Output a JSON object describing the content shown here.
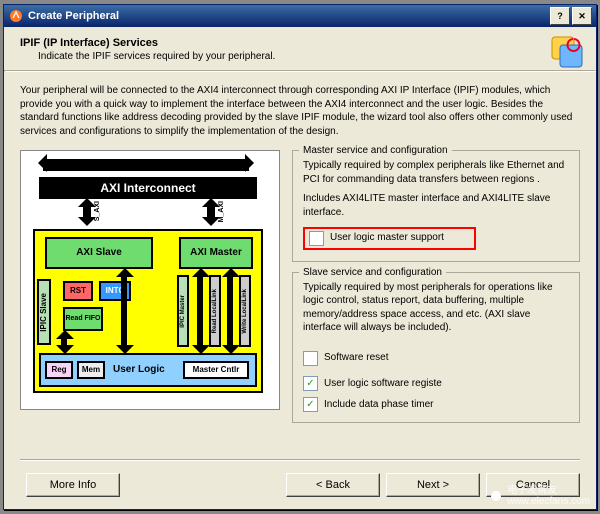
{
  "window": {
    "title": "Create Peripheral"
  },
  "header": {
    "title": "IPIF (IP Interface) Services",
    "subtitle": "Indicate the IPIF services required by your peripheral."
  },
  "intro": "Your peripheral will be connected to the AXI4 interconnect through corresponding AXI IP Interface (IPIF) modules, which provide you with a quick way to implement the interface between the AXI4 interconnect and the user logic. Besides the standard functions like address decoding provided by the slave IPIF module, the wizard tool also offers other commonly used services and configurations to simplify the implementation of the design.",
  "master": {
    "legend": "Master service and configuration",
    "desc1": "Typically required by complex peripherals like Ethernet and PCI for commanding data transfers between regions .",
    "desc2": "Includes AXI4LITE master interface and AXI4LITE slave interface.",
    "opt1": "User logic master support"
  },
  "slave": {
    "legend": "Slave service and configuration",
    "desc": "Typically required by most peripherals for operations like logic control, status report, data buffering, multiple memory/address space access, and etc. (AXI slave interface will always be included).",
    "opt1": "Software reset",
    "opt2": "User logic software registe",
    "opt3": "Include data phase timer"
  },
  "diagram": {
    "interconnect": "AXI Interconnect",
    "s_axi": "S_AXI",
    "m_axi": "M_AXI",
    "axi_slave": "AXI Slave",
    "axi_master": "AXI Master",
    "ipic_slave": "IPIC Slave",
    "ipic_master": "IPIC Master",
    "read_ll": "Read LocalLink",
    "write_ll": "Write LocalLink",
    "rst": "RST",
    "intc": "INTC",
    "read_fifo": "Read FIFO",
    "reg": "Reg",
    "mem": "Mem",
    "user_logic": "User Logic",
    "master_cntlr": "Master Cntlr"
  },
  "footer": {
    "more_info": "More Info",
    "back": "< Back",
    "next": "Next >",
    "cancel": "Cancel"
  },
  "watermark": "电子发烧友\nwww.elecfans.com"
}
